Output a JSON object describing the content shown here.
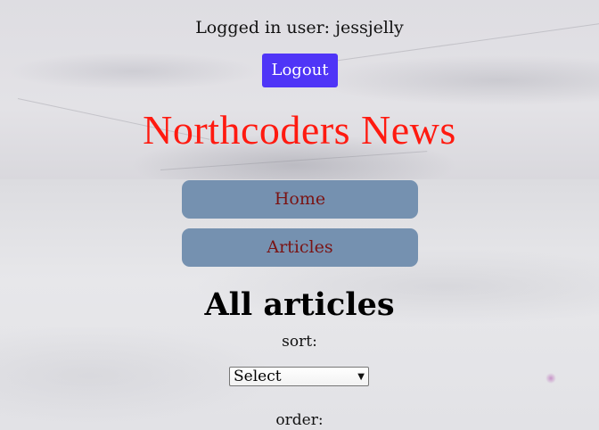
{
  "header": {
    "user_prefix": "Logged in user:",
    "username": "jessjelly",
    "user_line": "Logged in user: jessjelly",
    "logout_label": "Logout",
    "site_title": "Northcoders News"
  },
  "nav": {
    "items": [
      {
        "label": "Home"
      },
      {
        "label": "Articles"
      }
    ]
  },
  "main": {
    "heading": "All articles",
    "sort_label": "sort:",
    "sort_select": {
      "value": "Select",
      "icon": "dropdown-arrow-icon"
    },
    "order_label": "order:"
  },
  "colors": {
    "logout_button_bg": "#4f35f7",
    "title_color": "#ff1a10",
    "nav_bg": "#7591b0",
    "nav_text": "#7a1414"
  }
}
